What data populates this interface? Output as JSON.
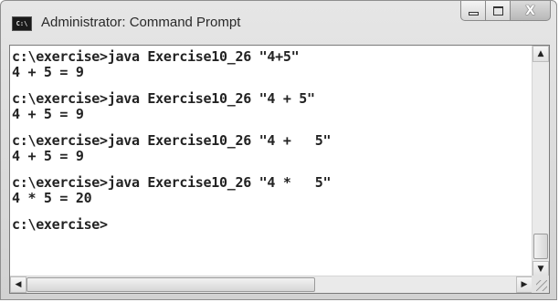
{
  "window": {
    "title": "Administrator: Command Prompt",
    "icon_text": "C:\\",
    "buttons": {
      "minimize_icon": "minimize-icon",
      "maximize_icon": "maximize-icon",
      "close_icon": "close-icon",
      "close_glyph": "X"
    }
  },
  "console": {
    "lines": [
      {
        "type": "command",
        "text": "c:\\exercise>java Exercise10_26 \"4+5\""
      },
      {
        "type": "output",
        "text": "4 + 5 = 9"
      },
      {
        "type": "command",
        "text": "c:\\exercise>java Exercise10_26 \"4 + 5\""
      },
      {
        "type": "output",
        "text": "4 + 5 = 9"
      },
      {
        "type": "command",
        "text": "c:\\exercise>java Exercise10_26 \"4 +   5\""
      },
      {
        "type": "output",
        "text": "4 + 5 = 9"
      },
      {
        "type": "command",
        "text": "c:\\exercise>java Exercise10_26 \"4 *   5\""
      },
      {
        "type": "output",
        "text": "4 * 5 = 20"
      },
      {
        "type": "command",
        "text": "c:\\exercise>"
      }
    ]
  },
  "scrollbars": {
    "up_arrow": "▲",
    "down_arrow": "▼",
    "left_arrow": "◀",
    "right_arrow": "▶"
  },
  "colors": {
    "console_background": "#ffffff",
    "console_text": "#222222",
    "frame": "#d2d2d2"
  }
}
